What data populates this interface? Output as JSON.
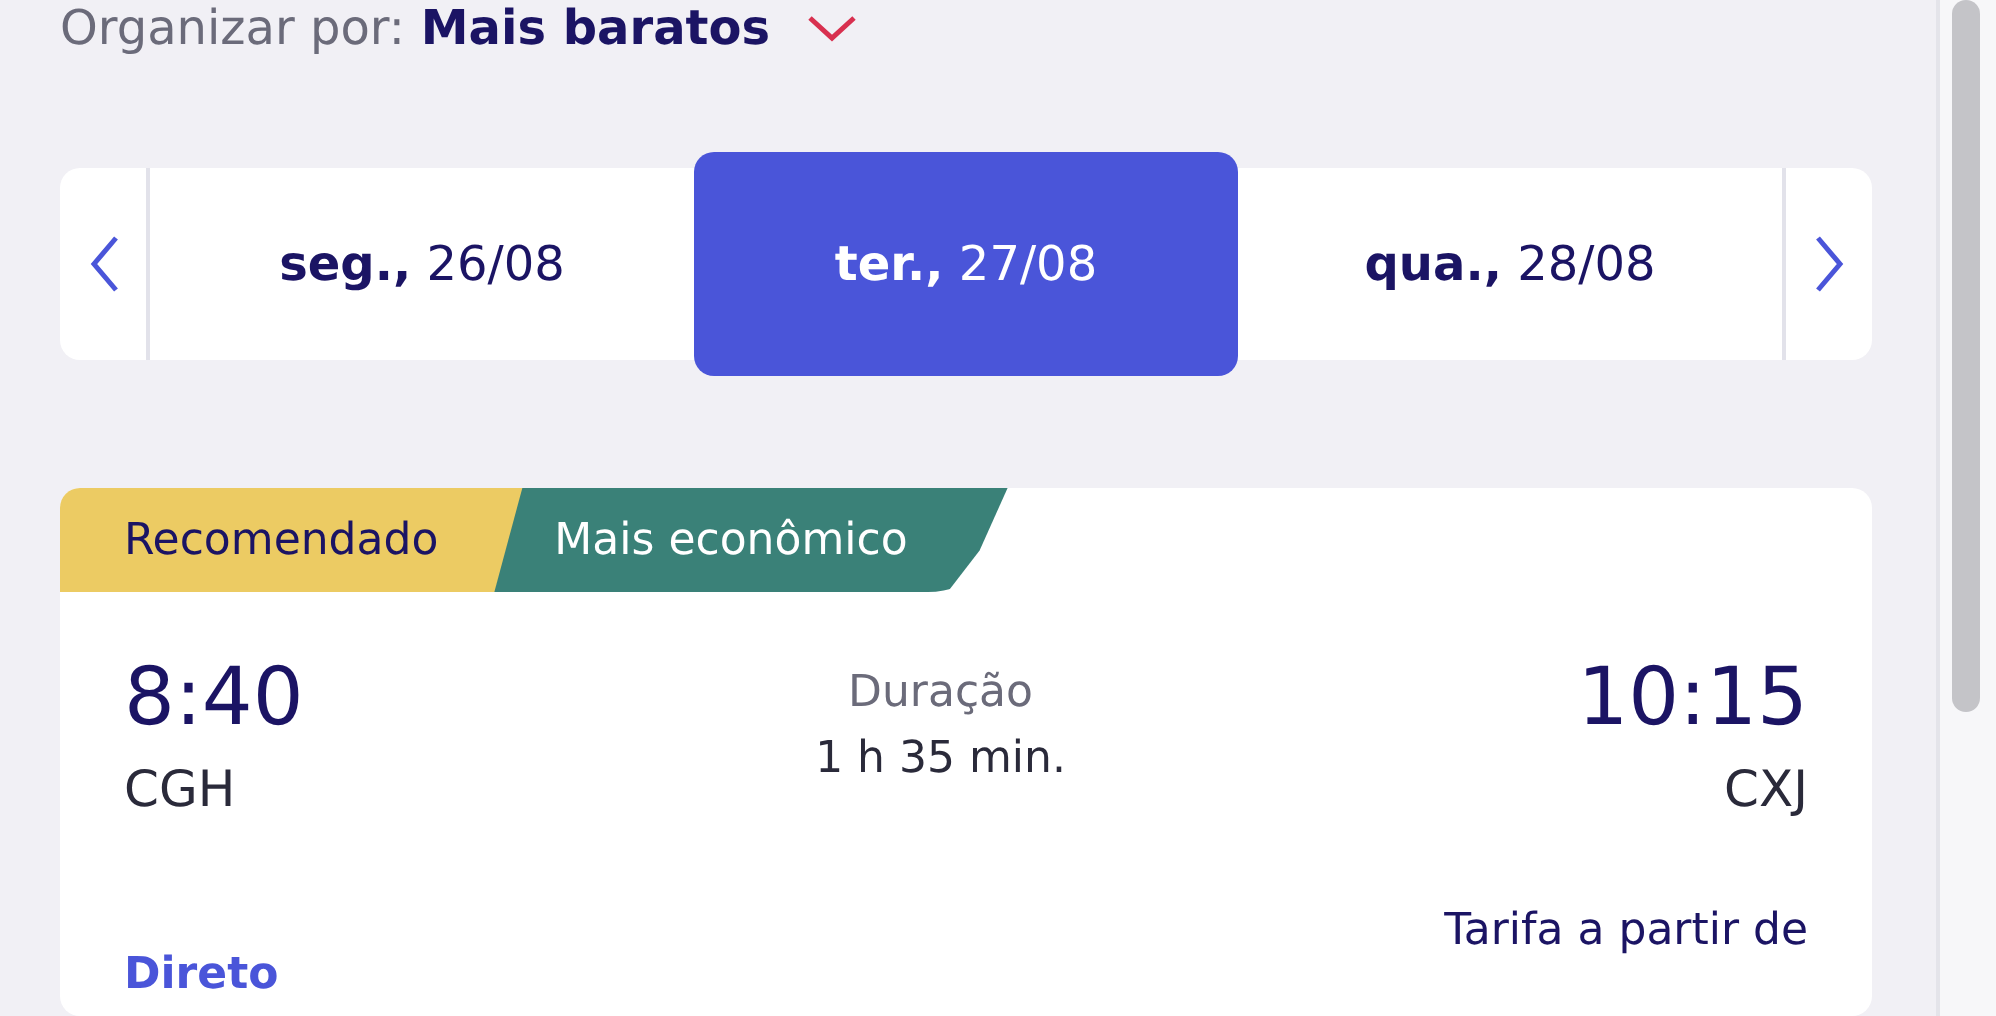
{
  "sort": {
    "label": "Organizar por:",
    "value": "Mais baratos"
  },
  "dates": [
    {
      "label": "**seg.,** 26/08",
      "selected": false
    },
    {
      "label": "**ter.,** 27/08",
      "selected": true
    },
    {
      "label": "**qua.,** 28/08",
      "selected": false
    }
  ],
  "flight": {
    "tags": [
      {
        "label": "Recomendado",
        "color": "#eccb63"
      },
      {
        "label": "Mais econômico",
        "color": "#3a8178"
      }
    ],
    "departure_time": "8:40",
    "departure_airport": "CGH",
    "duration_label": "Duração",
    "duration": "1 h 35 min.",
    "arrival_time": "10:15",
    "arrival_airport": "CXJ",
    "fare_label": "Tarifa a partir de",
    "stops": "Direto"
  }
}
